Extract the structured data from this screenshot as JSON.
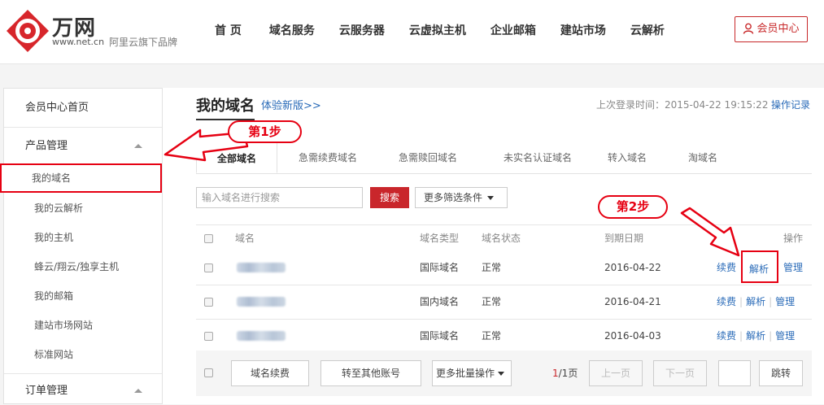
{
  "header": {
    "brand_name": "万网",
    "brand_url": "www.net.cn",
    "brand_sub": "阿里云旗下品牌",
    "nav": [
      "首 页",
      "域名服务",
      "云服务器",
      "云虚拟主机",
      "企业邮箱",
      "建站市场",
      "云解析"
    ],
    "member_center": "会员中心"
  },
  "sidebar": {
    "items": [
      {
        "label": "会员中心首页"
      },
      {
        "label": "产品管理"
      },
      {
        "label": "我的域名"
      },
      {
        "label": "我的云解析"
      },
      {
        "label": "我的主机"
      },
      {
        "label": "蜂云/翔云/独享主机"
      },
      {
        "label": "我的邮箱"
      },
      {
        "label": "建站市场网站"
      },
      {
        "label": "标准网站"
      },
      {
        "label": "订单管理"
      }
    ]
  },
  "main": {
    "title": "我的域名",
    "new_version_link": "体验新版>>",
    "last_login": "上次登录时间：2015-04-22 19:15:22",
    "operation_log": "操作记录",
    "tabs": [
      "全部域名",
      "急需续费域名",
      "急需赎回域名",
      "未实名认证域名",
      "转入域名",
      "淘域名"
    ],
    "search_placeholder": "输入域名进行搜索",
    "search_button": "搜索",
    "filter_button": "更多筛选条件",
    "table": {
      "headers": {
        "domain": "域名",
        "type": "域名类型",
        "status": "域名状态",
        "expiry": "到期日期",
        "ops": "操作"
      },
      "rows": [
        {
          "type": "国际域名",
          "status": "正常",
          "expiry": "2016-04-22"
        },
        {
          "type": "国内域名",
          "status": "正常",
          "expiry": "2016-04-21"
        },
        {
          "type": "国际域名",
          "status": "正常",
          "expiry": "2016-04-03"
        }
      ],
      "actions": {
        "renew": "续费",
        "resolve": "解析",
        "manage": "管理"
      }
    },
    "footer": {
      "renew_button": "域名续费",
      "transfer_button": "转至其他账号",
      "bulk_select": "更多批量操作",
      "page_current": "1",
      "page_total": "/1页",
      "prev": "上一页",
      "next": "下一页",
      "jump": "跳转"
    }
  },
  "annotations": {
    "step1": "第1步",
    "step2": "第2步"
  },
  "colors": {
    "accent_red": "#e60012",
    "link_blue": "#2a6bb8",
    "search_red": "#c9262b"
  }
}
